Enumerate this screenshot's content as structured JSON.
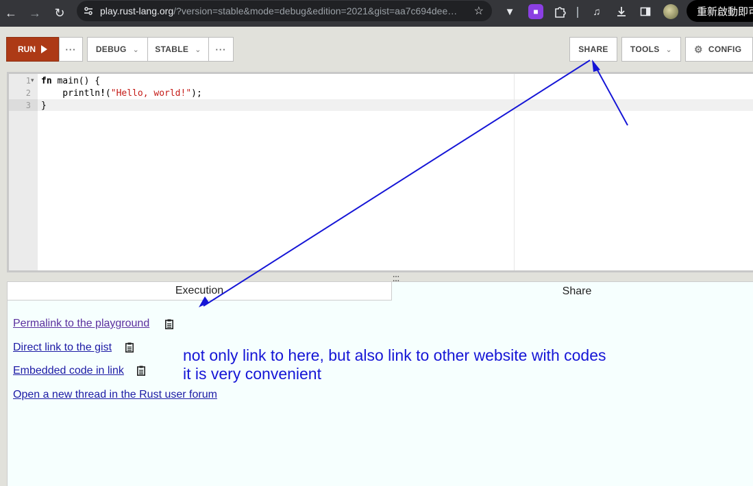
{
  "browser": {
    "url_host": "play.rust-lang.org",
    "url_rest": "/?version=stable&mode=debug&edition=2021&gist=aa7c694dee…",
    "restart_label": "重新啟動即可"
  },
  "toolbar": {
    "run_label": "RUN",
    "debug_label": "DEBUG",
    "stable_label": "STABLE",
    "share_label": "SHARE",
    "tools_label": "TOOLS",
    "config_label": "CONFIG",
    "more_label": "···"
  },
  "editor": {
    "line_numbers": [
      "1",
      "2",
      "3"
    ],
    "lines": [
      {
        "kw": "fn",
        "rest": " main() {"
      },
      {
        "indent": "    println",
        "bang": "!",
        "open": "(",
        "str": "\"Hello, world!\"",
        "close": ");"
      },
      {
        "text": "}"
      }
    ]
  },
  "output": {
    "tabs": [
      {
        "label": "Execution",
        "active": false
      },
      {
        "label": "Share",
        "active": true
      }
    ],
    "links": [
      {
        "label": "Permalink to the playground",
        "copy": true
      },
      {
        "label": "Direct link to the gist",
        "copy": true
      },
      {
        "label": "Embedded code in link",
        "copy": true
      },
      {
        "label": "Open a new thread in the Rust user forum",
        "copy": false
      }
    ]
  },
  "annotation": {
    "line1": "not only link to here, but also link to other website with codes",
    "line2": "it is very convenient",
    "color": "#1515d6"
  },
  "colors": {
    "run_button": "#ad3a16",
    "chrome_bg": "#35363a",
    "output_bg": "#f6fffe"
  }
}
